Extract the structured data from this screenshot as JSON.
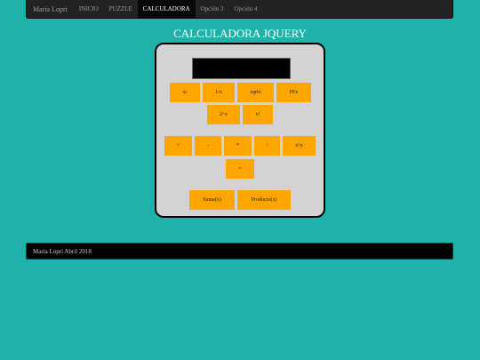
{
  "nav": {
    "brand": "Maria Lopri",
    "items": [
      {
        "label": "INICIO",
        "active": false
      },
      {
        "label": "PUZZLE",
        "active": false
      },
      {
        "label": "CALCULADORA",
        "active": true
      },
      {
        "label": "Opción 3",
        "active": false
      },
      {
        "label": "Opción 4",
        "active": false
      }
    ]
  },
  "page_title": "CALCULADORA JQUERY",
  "calculator": {
    "display_value": "",
    "unary_row1": {
      "square_base": "x",
      "square_exp": "2",
      "inverse": "1/x",
      "sqrt": "sqrtx",
      "pex": "PEx"
    },
    "unary_row2": {
      "pow2": "2^x",
      "factorial": "x!"
    },
    "binary_row": {
      "add": "+",
      "subtract": "-",
      "multiply": "*",
      "divide": "/",
      "power": "x^y"
    },
    "equals": "=",
    "list_ops": {
      "sum": "Suma(x)",
      "product": "Producto(x)"
    }
  },
  "footer": {
    "text": "Maria Lopri Abril 2018"
  },
  "colors": {
    "background": "#20b2aa",
    "navbar": "#222222",
    "button": "#ffa500",
    "calculator_body": "#d3d3d3",
    "display": "#000000"
  }
}
